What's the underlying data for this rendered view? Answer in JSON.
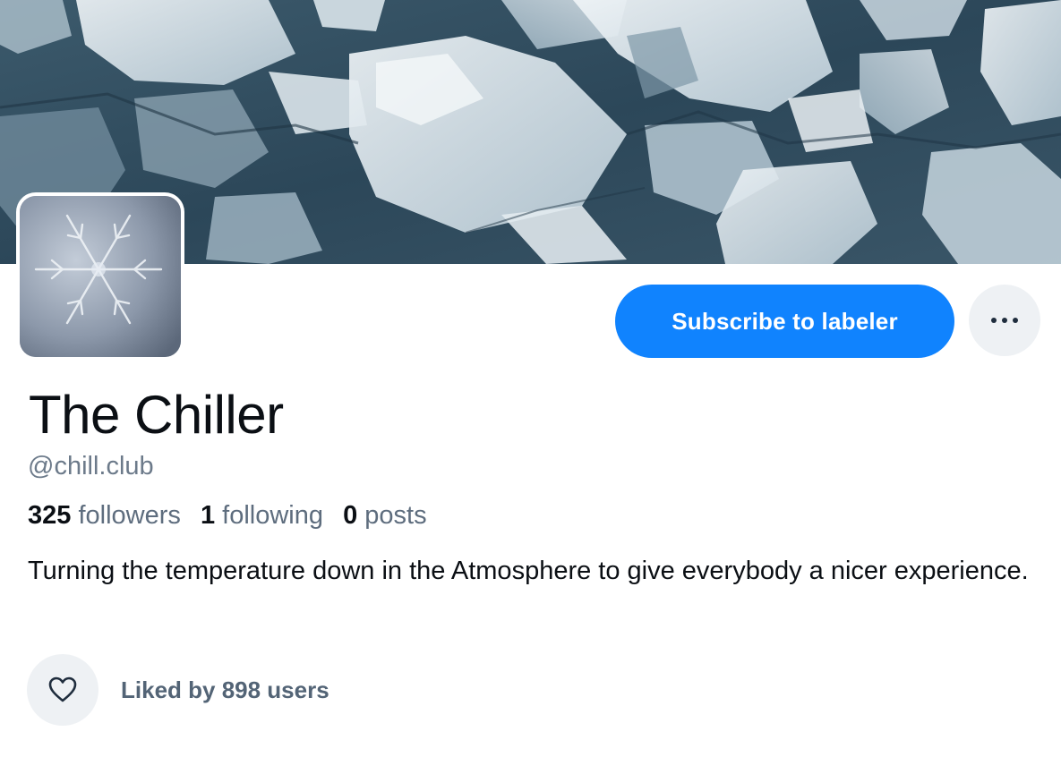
{
  "profile": {
    "display_name": "The Chiller",
    "handle": "@chill.club",
    "bio": "Turning the temperature down in the Atmosphere to give everybody a nicer experience."
  },
  "stats": {
    "followers_count": "325",
    "followers_label": "followers",
    "following_count": "1",
    "following_label": "following",
    "posts_count": "0",
    "posts_label": "posts"
  },
  "actions": {
    "subscribe_label": "Subscribe to labeler",
    "more_icon": "ellipsis-icon"
  },
  "likes": {
    "icon": "heart-outline-icon",
    "text": "Liked by 898 users"
  },
  "colors": {
    "accent": "#1083fe",
    "secondary_text": "#6c7a8a",
    "button_bg": "#eef1f4"
  },
  "images": {
    "banner": "ice-banner",
    "avatar": "snowflake-avatar"
  }
}
